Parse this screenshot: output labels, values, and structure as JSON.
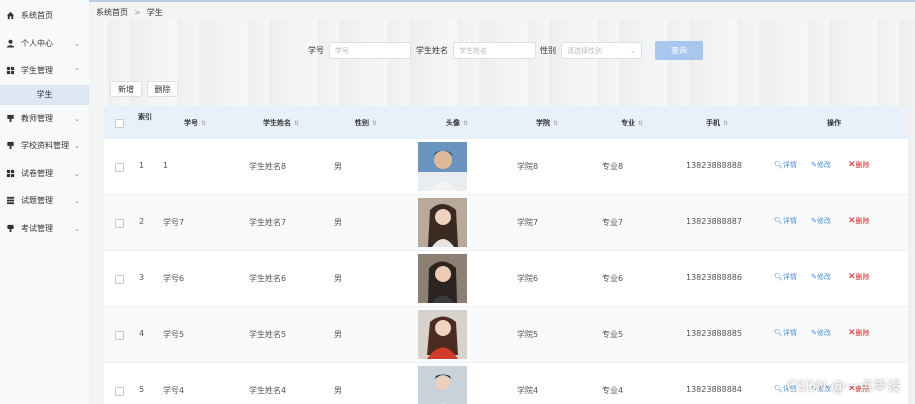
{
  "sidebar": {
    "items": [
      {
        "label": "系统首页",
        "icon": "home-icon"
      },
      {
        "label": "个人中心",
        "icon": "user-icon"
      },
      {
        "label": "学生管理",
        "icon": "grid-icon",
        "open": true
      },
      {
        "label": "教师管理",
        "icon": "teacher-icon"
      },
      {
        "label": "学校资料管理",
        "icon": "book-icon"
      },
      {
        "label": "试卷管理",
        "icon": "grid-icon"
      },
      {
        "label": "试题管理",
        "icon": "list-icon"
      },
      {
        "label": "考试管理",
        "icon": "exam-icon"
      }
    ],
    "subitem": "学生"
  },
  "breadcrumb": {
    "home": "系统首页",
    "separator": ">",
    "current": "学生"
  },
  "search": {
    "id_label": "学号",
    "id_placeholder": "学号",
    "name_label": "学生姓名",
    "name_placeholder": "学生姓名",
    "gender_label": "性别",
    "gender_placeholder": "请选择性别",
    "query_button": "查询"
  },
  "toolbar": {
    "add_label": "新增",
    "delete_label": "删除"
  },
  "table": {
    "headers": [
      "索引",
      "学号",
      "学生姓名",
      "性别",
      "头像",
      "学院",
      "专业",
      "手机",
      "操作"
    ],
    "actions": {
      "detail": "详情",
      "edit": "修改",
      "delete": "删除"
    },
    "rows": [
      {
        "index": "1",
        "id": "1",
        "name": "学生姓名8",
        "gender": "男",
        "college": "学院8",
        "major": "专业8",
        "phone": "13823888888"
      },
      {
        "index": "2",
        "id": "学号7",
        "name": "学生姓名7",
        "gender": "男",
        "college": "学院7",
        "major": "专业7",
        "phone": "13823888887"
      },
      {
        "index": "3",
        "id": "学号6",
        "name": "学生姓名6",
        "gender": "男",
        "college": "学院6",
        "major": "专业6",
        "phone": "13823888886"
      },
      {
        "index": "4",
        "id": "学号5",
        "name": "学生姓名5",
        "gender": "男",
        "college": "学院5",
        "major": "专业5",
        "phone": "13823888885"
      },
      {
        "index": "5",
        "id": "学号4",
        "name": "学生姓名4",
        "gender": "男",
        "college": "学院4",
        "major": "专业4",
        "phone": "13823888884"
      }
    ]
  },
  "watermark": "CSDN @一点毕设",
  "colors": {
    "accent": "#4a90d9",
    "danger": "#e02020",
    "header_bg": "#e8f0fa",
    "query_button": "#a9c7ee"
  }
}
